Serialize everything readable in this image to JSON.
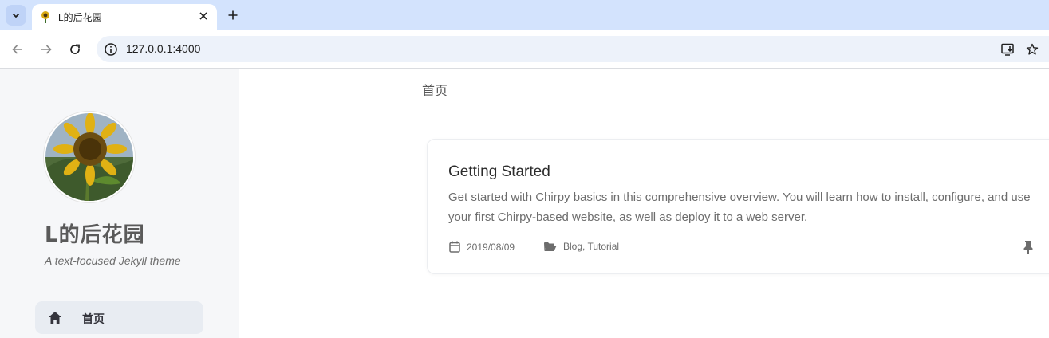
{
  "browser": {
    "tab_title": "L的后花园",
    "url": "127.0.0.1:4000",
    "icons": {
      "tab_search": "chevron-down-icon",
      "favicon": "sunflower-favicon",
      "close": "close-icon",
      "new_tab": "plus-icon",
      "back": "arrow-left-icon",
      "forward": "arrow-right-icon",
      "reload": "reload-icon",
      "site_info": "info-icon",
      "install": "install-app-icon",
      "bookmark": "star-icon"
    }
  },
  "sidebar": {
    "avatar": "sunflower-avatar",
    "title": "L的后花园",
    "subtitle": "A text-focused Jekyll theme",
    "nav": [
      {
        "label": "首页",
        "icon": "home-icon",
        "active": true
      }
    ]
  },
  "main": {
    "breadcrumb": "首页",
    "posts": [
      {
        "title": "Getting Started",
        "excerpt": "Get started with Chirpy basics in this comprehensive overview. You will learn how to install, configure, and use your first Chirpy-based website, as well as deploy it to a web server.",
        "date": "2019/08/09",
        "categories": "Blog, Tutorial",
        "pinned": true
      }
    ]
  },
  "colors": {
    "tabstrip": "#d3e3fd",
    "omnibox": "#edf2fa",
    "sidebar_bg": "#f6f7f9",
    "nav_active_bg": "#e8ecf2"
  }
}
